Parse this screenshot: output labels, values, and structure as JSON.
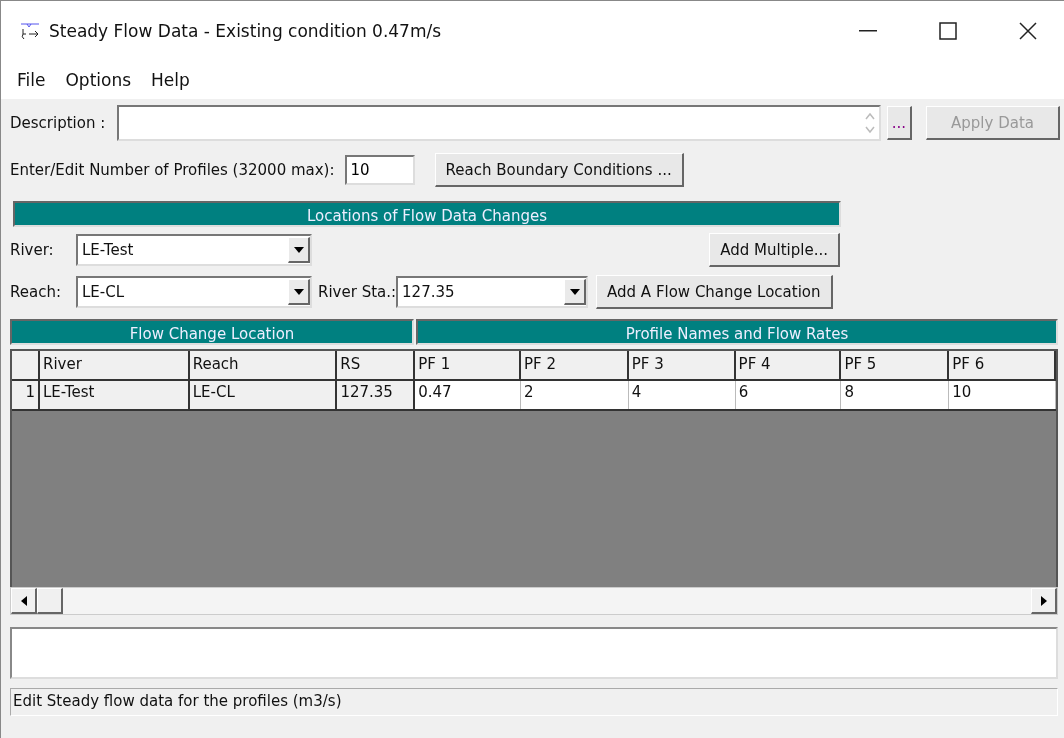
{
  "window": {
    "title": "Steady Flow Data - Existing condition 0.47m/s"
  },
  "menu": [
    "File",
    "Options",
    "Help"
  ],
  "description": {
    "label": "Description :",
    "more_button": "...",
    "apply_button": {
      "label": "Apply Data",
      "disabled": true
    }
  },
  "profiles": {
    "label": "Enter/Edit Number of Profiles (32000 max):",
    "value": "10",
    "boundary_button": "Reach Boundary Conditions ..."
  },
  "locations": {
    "title": "Locations of Flow Data Changes",
    "river_label": "River:",
    "river": "LE-Test",
    "add_multiple": "Add Multiple...",
    "reach_label": "Reach:",
    "reach": "LE-CL",
    "station_label": "River Sta.:",
    "station": "127.35",
    "add_location": "Add A Flow Change Location"
  },
  "table": {
    "groups": [
      "Flow Change Location",
      "Profile Names and Flow Rates"
    ],
    "columns": [
      "River",
      "Reach",
      "RS",
      "PF 1",
      "PF 2",
      "PF 3",
      "PF 4",
      "PF 5",
      "PF 6"
    ],
    "rows": [
      {
        "number": "1",
        "cells": [
          "LE-Test",
          "LE-CL",
          "127.35",
          "0.47",
          "2",
          "4",
          "6",
          "8",
          "10"
        ]
      }
    ]
  },
  "status_bar": "Edit Steady flow data for the profiles (m3/s)"
}
